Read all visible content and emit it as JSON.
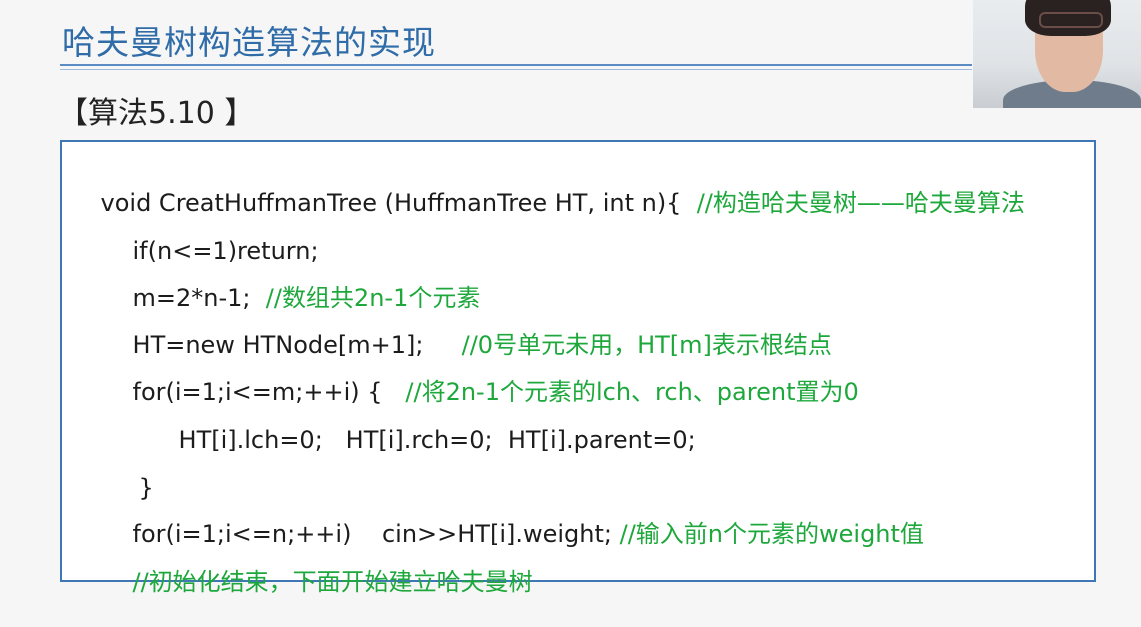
{
  "slide": {
    "title": "哈夫曼树构造算法的实现",
    "algorithm_label": "【算法5.10 】"
  },
  "code": {
    "lines": [
      {
        "code": "void CreatHuffmanTree (HuffmanTree HT, int n){  ",
        "comment": "//构造哈夫曼树——哈夫曼算法"
      },
      {
        "code": "if(n<=1)return;",
        "comment": ""
      },
      {
        "code": "m=2*n-1;  ",
        "comment": "//数组共2n-1个元素"
      },
      {
        "code": "HT=new HTNode[m+1];     ",
        "comment": "//0号单元未用，HT[m]表示根结点"
      },
      {
        "code": "for(i=1;i<=m;++i) {   ",
        "comment": "//将2n-1个元素的lch、rch、parent置为0"
      },
      {
        "code": "HT[i].lch=0;   HT[i].rch=0;  HT[i].parent=0;",
        "comment": ""
      },
      {
        "code": "}",
        "comment": ""
      },
      {
        "code": "for(i=1;i<=n;++i)    cin>>HT[i].weight; ",
        "comment": "//输入前n个元素的weight值"
      },
      {
        "code": "",
        "comment": "//初始化结束，下面开始建立哈夫曼树"
      }
    ]
  }
}
